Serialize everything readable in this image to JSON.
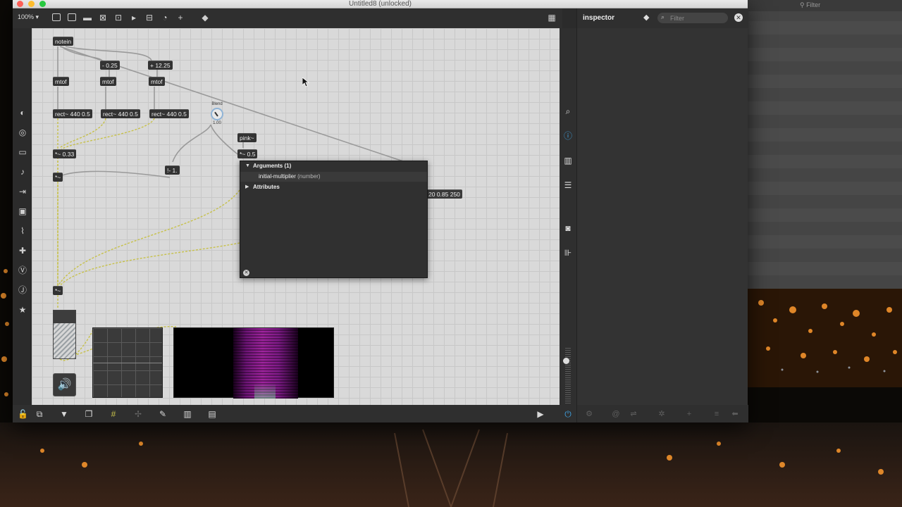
{
  "window": {
    "title": "Untitled8 (unlocked)",
    "zoom_level": "100% ▾"
  },
  "patcher": {
    "objects": {
      "notein": "notein",
      "minus": "- 0.25",
      "plus": "+ 12.25",
      "mtof1": "mtof",
      "mtof2": "mtof",
      "mtof3": "mtof",
      "rect1": "rect~ 440 0.5",
      "rect2": "rect~ 440 0.5",
      "rect3": "rect~ 440 0.5",
      "times033": "*~ 0.33",
      "times": "*~",
      "rminus": "!- 1.",
      "pink": "pink~",
      "times05": "*~ 0.5",
      "times_out": "*~",
      "adsr_msg": "20 0.85 250"
    },
    "dial": {
      "label": "Blend",
      "value": "1.00"
    }
  },
  "help_popup": {
    "arguments_label": "Arguments (1)",
    "argument_name": "initial-multiplier",
    "argument_type": "(number)",
    "attributes_label": "Attributes"
  },
  "inspector": {
    "title": "inspector",
    "search_placeholder": "Filter"
  },
  "background_window": {
    "filter_label": "Filter"
  },
  "colors": {
    "canvas": "#d9d9d9",
    "object_box": "#333333",
    "signal_cord": "#c7c14a",
    "control_cord": "#9a9a9a",
    "accent_blue": "#3fa1e0"
  }
}
